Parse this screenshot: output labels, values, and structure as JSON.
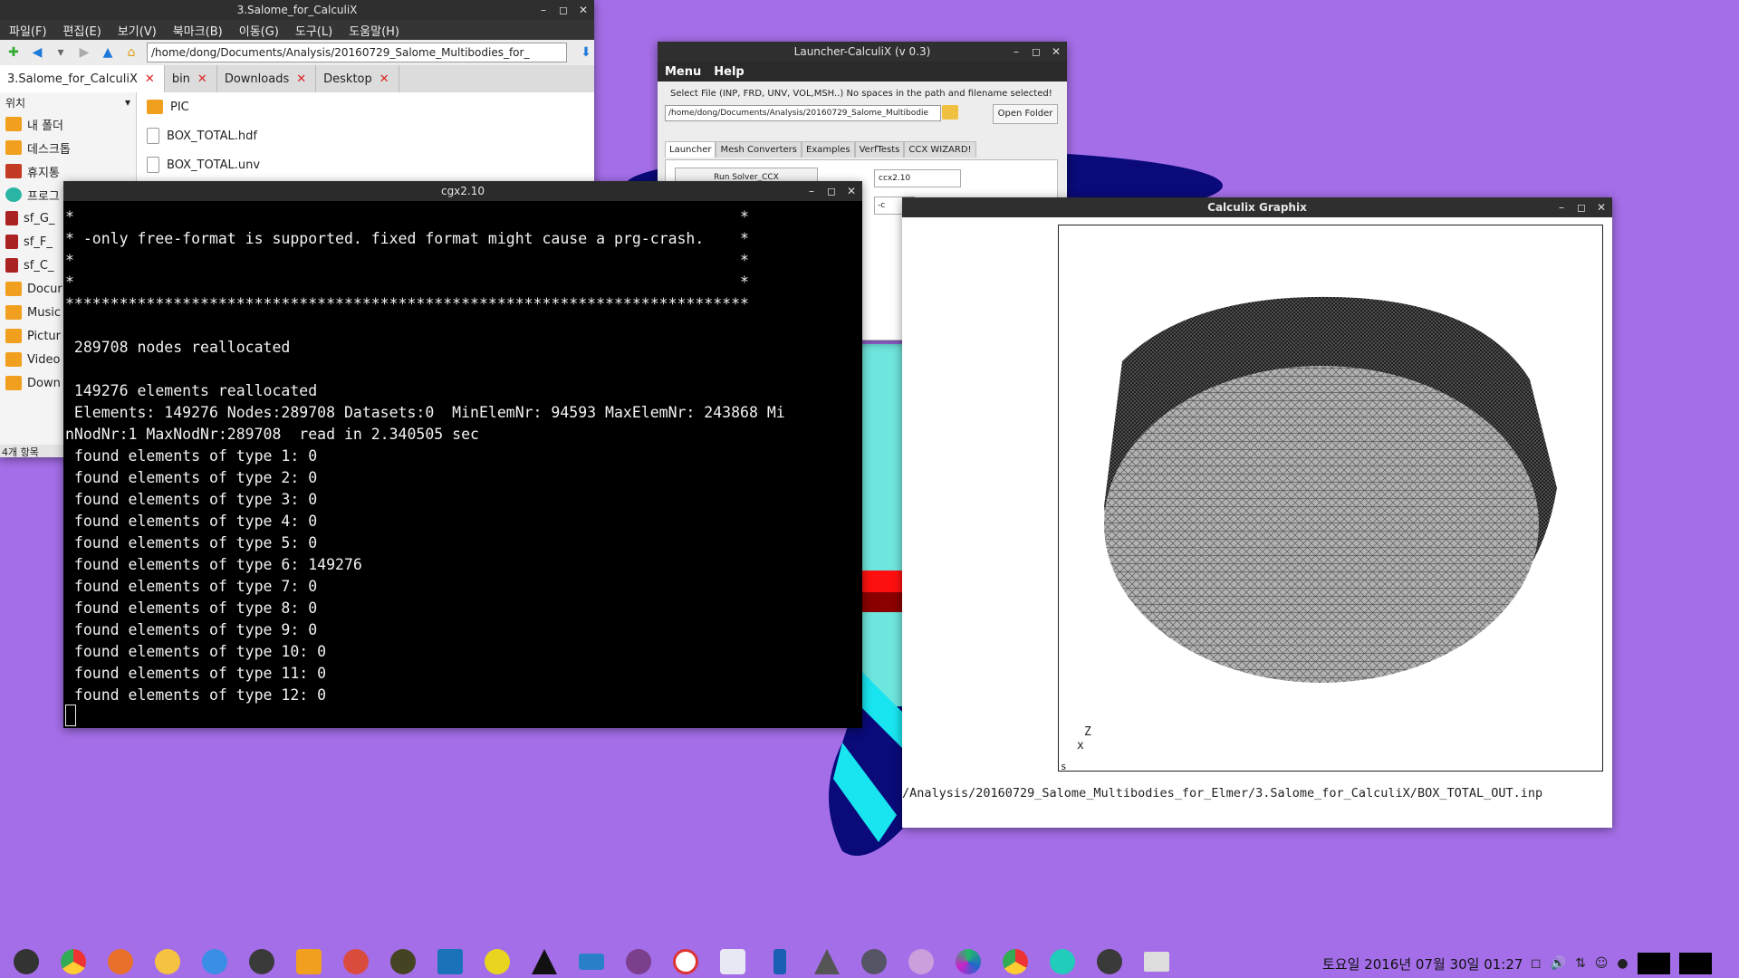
{
  "file_manager": {
    "title": "3.Salome_for_CalculiX",
    "menus": [
      "파일(F)",
      "편집(E)",
      "보기(V)",
      "북마크(B)",
      "이동(G)",
      "도구(L)",
      "도움말(H)"
    ],
    "path": "/home/dong/Documents/Analysis/20160729_Salome_Multibodies_for_",
    "tabs": [
      "3.Salome_for_CalculiX",
      "bin",
      "Downloads",
      "Desktop"
    ],
    "side_heading": "위치",
    "side_items": [
      "내 폴더",
      "데스크톱",
      "휴지통",
      "프로그",
      "sf_G_",
      "sf_F_",
      "sf_C_",
      "Docur",
      "Music",
      "Pictur",
      "Video",
      "Down"
    ],
    "files": [
      "PIC",
      "BOX_TOTAL.hdf",
      "BOX_TOTAL.unv"
    ],
    "status": "4개 항목"
  },
  "launcher": {
    "title": "Launcher-CalculiX (v 0.3)",
    "menus": [
      "Menu",
      "Help"
    ],
    "hint": "Select File (INP, FRD, UNV, VOL,MSH..) No spaces in the path and filename selected!",
    "path": "/home/dong/Documents/Analysis/20160729_Salome_Multibodie",
    "open_folder": "Open Folder",
    "tabs": [
      "Launcher",
      "Mesh Converters",
      "Examples",
      "VerfTests",
      "CCX WIZARD!"
    ],
    "run_button": "Run Solver_CCX",
    "solver": "ccx2.10",
    "option": "-c"
  },
  "terminal": {
    "title": "cgx2.10",
    "lines": [
      "*                                                                          *",
      "* -only free-format is supported. fixed format might cause a prg-crash.    *",
      "*                                                                          *",
      "*                                                                          *",
      "****************************************************************************",
      "",
      " 289708 nodes reallocated",
      "",
      " 149276 elements reallocated",
      " Elements: 149276 Nodes:289708 Datasets:0  MinElemNr: 94593 MaxElemNr: 243868 Mi",
      "nNodNr:1 MaxNodNr:289708  read in 2.340505 sec",
      " found elements of type 1: 0",
      " found elements of type 2: 0",
      " found elements of type 3: 0",
      " found elements of type 4: 0",
      " found elements of type 5: 0",
      " found elements of type 6: 149276",
      " found elements of type 7: 0",
      " found elements of type 8: 0",
      " found elements of type 9: 0",
      " found elements of type 10: 0",
      " found elements of type 11: 0",
      " found elements of type 12: 0"
    ]
  },
  "graphix": {
    "title": "Calculix Graphix",
    "file_path": "/Analysis/20160729_Salome_Multibodies_for_Elmer/3.Salome_for_CalculiX/BOX_TOTAL_OUT.inp",
    "corner_label": "s",
    "axis_label": "Z",
    "axis_x": "x"
  },
  "taskbar": {
    "clock": "토요일 2016년 07월 30일 01:27"
  }
}
